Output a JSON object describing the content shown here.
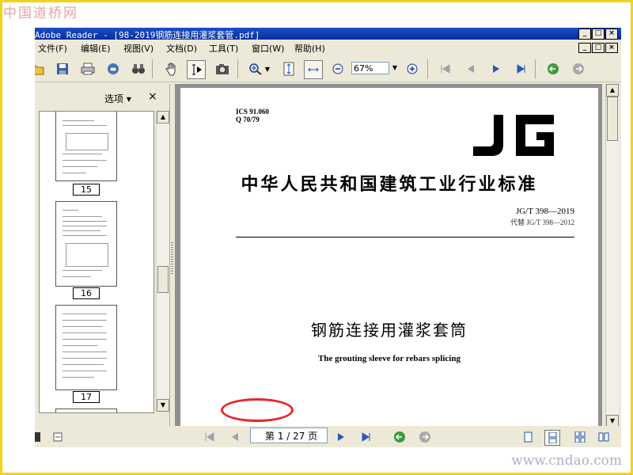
{
  "watermark": {
    "site_logo": "中国道桥网",
    "site_url": "www.cndao.com"
  },
  "window": {
    "title": "Adobe Reader - [98-2019钢筋连接用灌浆套管.pdf]",
    "buttons": [
      "_",
      "□",
      "×"
    ],
    "doc_buttons": [
      "_",
      "□",
      "×"
    ]
  },
  "menu": [
    "文件(F)",
    "编辑(E)",
    "视图(V)",
    "文档(D)",
    "工具(T)",
    "窗口(W)",
    "帮助(H)"
  ],
  "toolbar": {
    "zoom_value": "67%"
  },
  "nav_panel": {
    "options_label": "选项 ▾",
    "close_label": "×",
    "thumbnails": [
      "15",
      "16",
      "17"
    ]
  },
  "document": {
    "ics": "ICS 91.060",
    "class_code": "Q 70/79",
    "logo_text": "JG",
    "standard_title": "中华人民共和国建筑工业行业标准",
    "standard_number": "JG/T 398—2019",
    "replaces": "代替 JG/T 398—2012",
    "cn_title": "钢筋连接用灌浆套筒",
    "en_title": "The grouting sleeve for rebars splicing"
  },
  "statusbar": {
    "page_indicator": "第 1 / 27 页"
  },
  "colors": {
    "titlebar": "#0a2c9a",
    "frame": "#f2d21a",
    "annotation": "#e8262b"
  }
}
